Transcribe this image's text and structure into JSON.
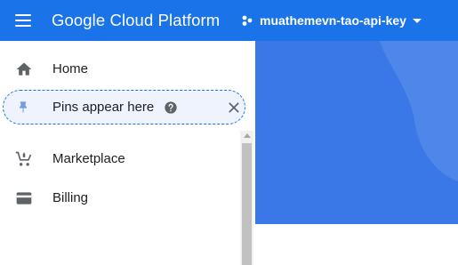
{
  "header": {
    "brand": "Google Cloud Platform",
    "project": "muathemevn-tao-api-key",
    "icons": [
      "menu-icon",
      "project-dots-icon",
      "caret-down-icon"
    ]
  },
  "nav": {
    "home": "Home",
    "pins": "Pins appear here",
    "marketplace": "Marketplace",
    "billing": "Billing"
  },
  "colors": {
    "topbar": "#1a73e8",
    "pins_bg": "#eef3fd",
    "pins_border": "#1a73e8",
    "main_blue": "#3b78e7",
    "main_light": "#4f86ea"
  }
}
